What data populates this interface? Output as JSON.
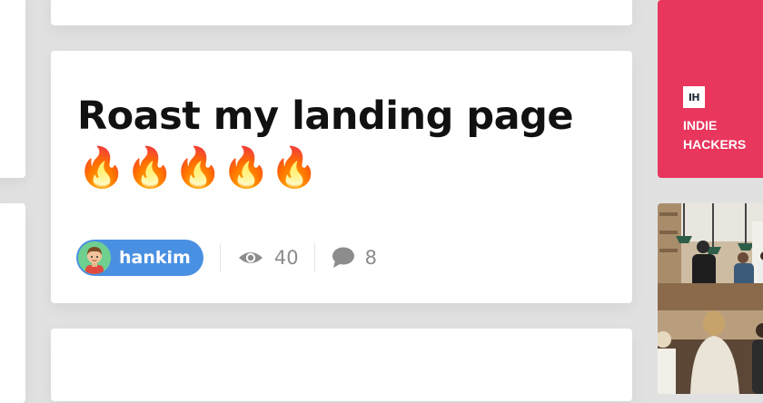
{
  "post": {
    "title": "Roast my landing page 🔥🔥🔥🔥🔥",
    "author": "hankim",
    "views": "40",
    "comments": "8"
  },
  "sidebar": {
    "ad_logo": "IH",
    "ad_name": "INDIE\nHACKERS"
  },
  "icons": {
    "avatar": "avatar",
    "views": "eye-icon",
    "comments": "speech-bubble-icon",
    "logo": "indie-hackers-logo"
  },
  "colors": {
    "background": "#e1e1e1",
    "card": "#ffffff",
    "author_pill": "#4a90e2",
    "ad_card": "#e8365d",
    "meta_text": "#8c8c8c",
    "title_text": "#111111"
  }
}
